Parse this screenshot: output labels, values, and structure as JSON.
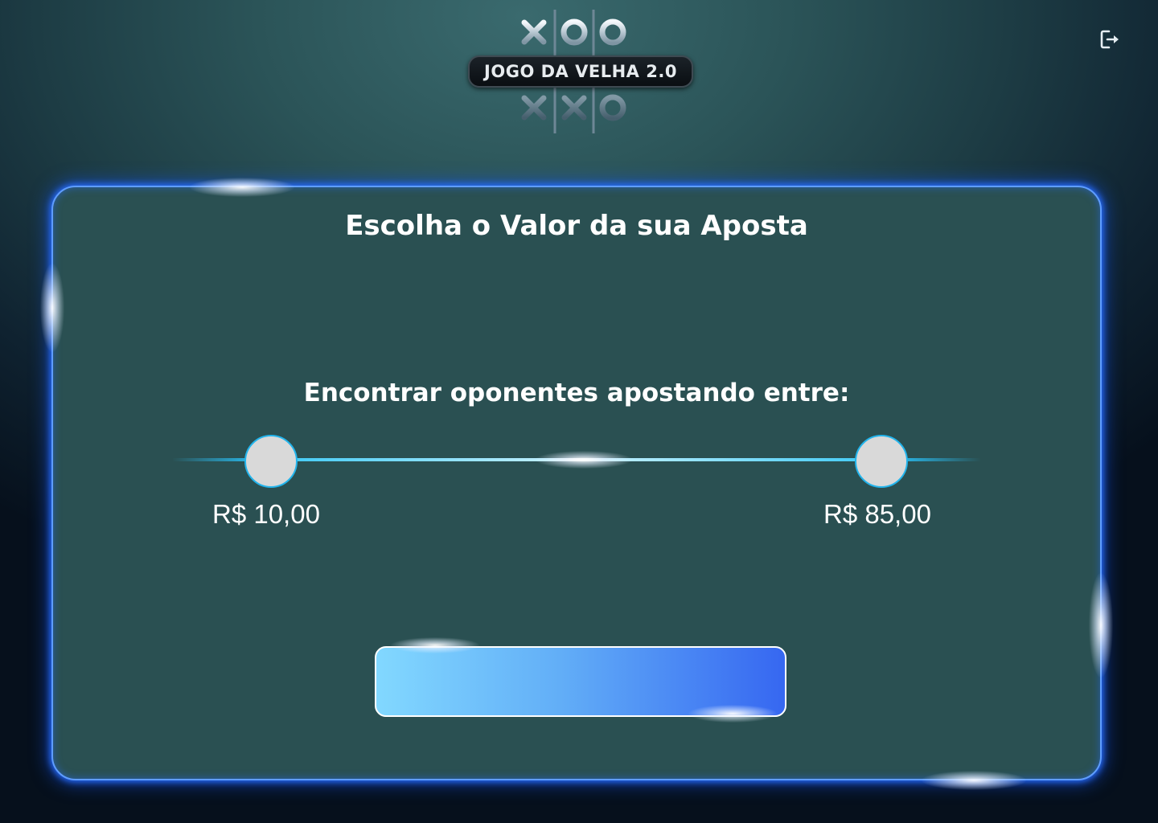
{
  "header": {
    "logo_text": "JOGO DA VELHA 2.0"
  },
  "bet_card": {
    "title": "Escolha o Valor da sua Aposta",
    "range_label": "Encontrar oponentes apostando entre:",
    "slider": {
      "min_value": "R$ 10,00",
      "max_value": "R$ 85,00"
    },
    "button_label": ""
  },
  "icons": {
    "logout": "logout-icon"
  },
  "colors": {
    "card_background": "#2a5052",
    "card_border": "#5f9dff",
    "slider_track": "#29b6e8",
    "thumb": "#d9d9d9",
    "button_gradient_start": "#82d8ff",
    "button_gradient_end": "#3667f1"
  }
}
